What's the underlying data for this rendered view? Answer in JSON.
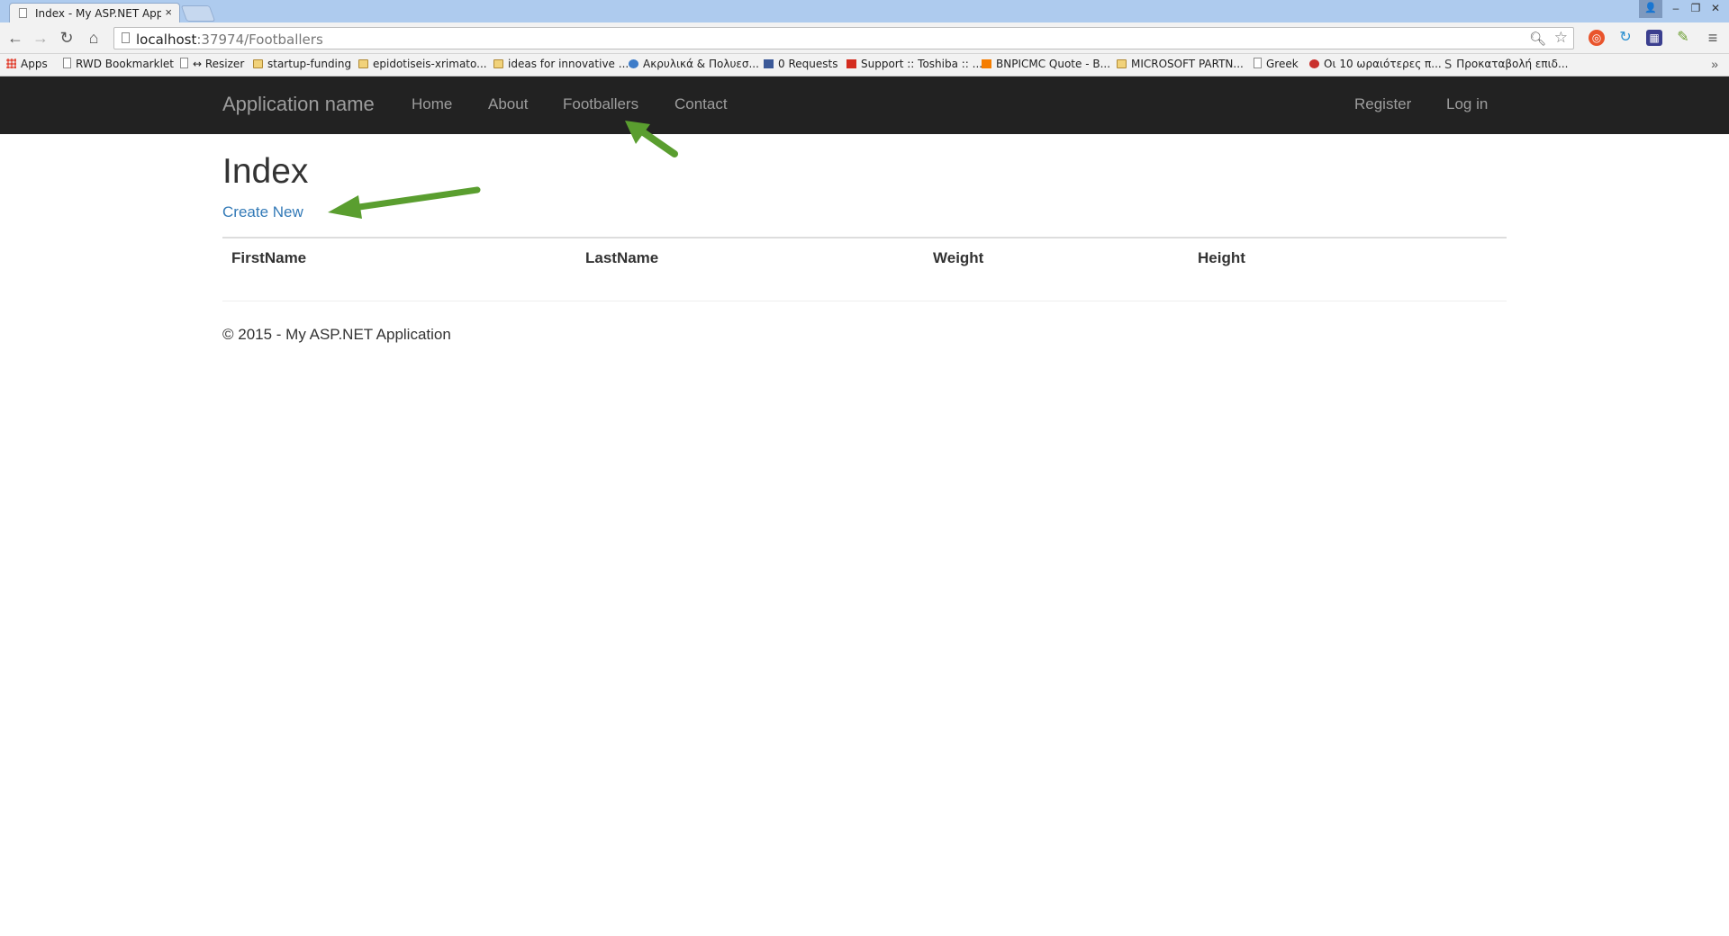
{
  "browser": {
    "tab_title": "Index - My ASP.NET Appli",
    "tab_close": "×",
    "url_host": "localhost",
    "url_rest": ":37974/Footballers",
    "window_buttons": [
      "–",
      "❐",
      "✕"
    ]
  },
  "bookmarks": [
    {
      "label": "Apps",
      "icon": "apps"
    },
    {
      "label": "RWD Bookmarklet",
      "icon": "page"
    },
    {
      "label": "↔ Resizer",
      "icon": "page"
    },
    {
      "label": "startup-funding",
      "icon": "folder"
    },
    {
      "label": "epidotiseis-xrimato...",
      "icon": "folder"
    },
    {
      "label": "ideas for innovative ...",
      "icon": "folder"
    },
    {
      "label": "Ακρυλικά & Πολυεσ...",
      "icon": "globe"
    },
    {
      "label": "0 Requests",
      "icon": "fb"
    },
    {
      "label": "Support :: Toshiba :: ...",
      "icon": "t"
    },
    {
      "label": "BNPICMC Quote - B...",
      "icon": "b"
    },
    {
      "label": "MICROSOFT PARTN...",
      "icon": "folder"
    },
    {
      "label": "Greek",
      "icon": "page"
    },
    {
      "label": "Οι 10 ωραιότερες π...",
      "icon": "red"
    },
    {
      "label": "Προκαταβολή επιδ...",
      "icon": "s"
    }
  ],
  "navbar": {
    "brand": "Application name",
    "links": [
      "Home",
      "About",
      "Footballers",
      "Contact"
    ],
    "register": "Register",
    "login": "Log in"
  },
  "main": {
    "title": "Index",
    "create_link": "Create New",
    "columns": [
      "FirstName",
      "LastName",
      "Weight",
      "Height"
    ]
  },
  "footer": {
    "text": "© 2015 - My ASP.NET Application"
  },
  "colors": {
    "navbar_bg": "#222222",
    "link": "#337ab7",
    "annotation_arrow": "#5a9e2f"
  }
}
